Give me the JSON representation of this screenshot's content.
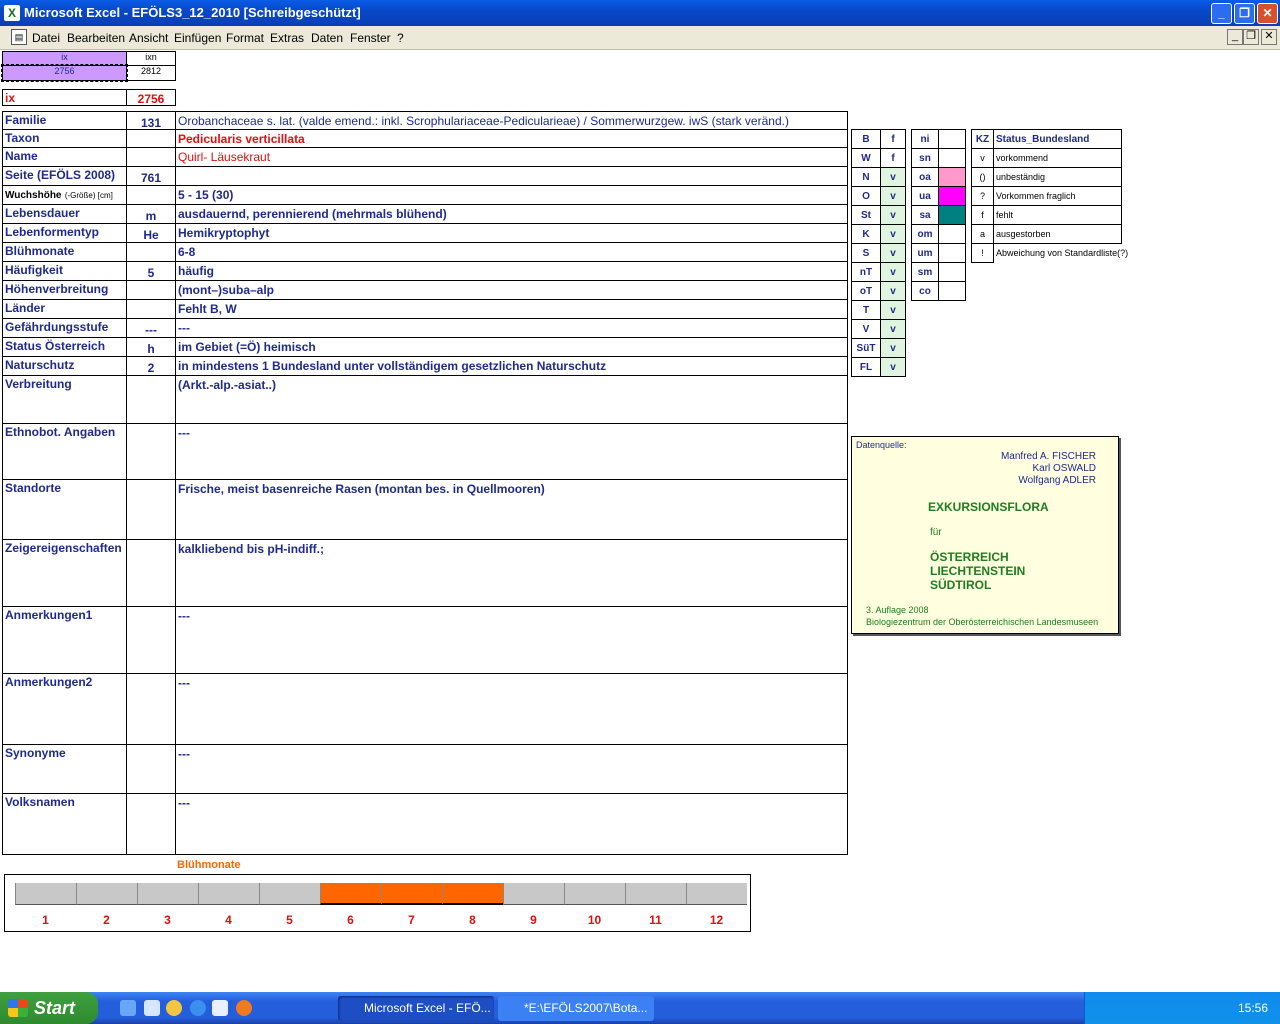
{
  "window": {
    "title": "Microsoft Excel - EFÖLS3_12_2010  [Schreibgeschützt]",
    "btn_min": "_",
    "btn_restore": "❐",
    "btn_close": "✕"
  },
  "menu": [
    "Datei",
    "Bearbeiten",
    "Ansicht",
    "Einfügen",
    "Format",
    "Extras",
    "Daten",
    "Fenster",
    "?"
  ],
  "mdi": {
    "min": "_",
    "restore": "❐",
    "close": "✕"
  },
  "index": {
    "h1": "ix",
    "h2": "ixn",
    "v1": "2756",
    "v2": "2812",
    "ix_label": "ix",
    "ix_value": "2756"
  },
  "rows": [
    {
      "label": "Familie",
      "code": "131",
      "value": "Orobanchaceae s. lat. (valde emend.: inkl. Scrophulariaceae-Pedicularieae)  /  Sommerwurzgew. iwS (stark veränd.)"
    },
    {
      "label": "Taxon",
      "code": "",
      "value": "Pedicularis verticillata"
    },
    {
      "label": "Name",
      "code": "",
      "value": "Quirl- Läusekraut"
    },
    {
      "label": "Seite (EFÖLS 2008)",
      "code": "761",
      "value": ""
    },
    {
      "label": "Wuchshöhe",
      "label_small": "(-Größe) [cm]",
      "code": "",
      "value": " 5 - 15 (30)"
    },
    {
      "label": "Lebensdauer",
      "code": "m",
      "value": "ausdauernd, perennierend (mehrmals blühend)"
    },
    {
      "label": "Lebenformentyp",
      "code": "He",
      "value": "Hemikryptophyt"
    },
    {
      "label": "Blühmonate",
      "code": "",
      "value": " 6-8"
    },
    {
      "label": "Häufigkeit",
      "code": "5",
      "value": "häufig"
    },
    {
      "label": "Höhenverbreitung",
      "code": "",
      "value": "(mont–)suba–alp"
    },
    {
      "label": "Länder",
      "code": "",
      "value": "Fehlt B, W"
    },
    {
      "label": "Gefährdungsstufe",
      "code": "---",
      "value": "   ---"
    },
    {
      "label": "Status Österreich",
      "code": "h",
      "value": "im Gebiet (=Ö) heimisch"
    },
    {
      "label": "Naturschutz",
      "code": "2",
      "value": "in mindestens 1 Bundesland unter vollständigem gesetzlichen Naturschutz"
    },
    {
      "label": "Verbreitung",
      "code": "",
      "value": "(Arkt.-alp.-asiat..)"
    },
    {
      "label": "Ethnobot. Angaben",
      "code": "",
      "value": "---"
    },
    {
      "label": "Standorte",
      "code": "",
      "value": "Frische, meist basenreiche Rasen (montan bes. in Quellmooren)"
    },
    {
      "label": "Zeigereigenschaften",
      "code": "",
      "value": "kalkliebend bis pH-indiff.;"
    },
    {
      "label": "Anmerkungen1",
      "code": "",
      "value": "---"
    },
    {
      "label": "Anmerkungen2",
      "code": "",
      "value": "---"
    },
    {
      "label": "Synonyme",
      "code": "",
      "value": "---"
    },
    {
      "label": "Volksnamen",
      "code": "",
      "value": "---"
    }
  ],
  "states": {
    "h1": "B",
    "h2": "f",
    "rows": [
      [
        "W",
        "f"
      ],
      [
        "N",
        "v"
      ],
      [
        "O",
        "v"
      ],
      [
        "St",
        "v"
      ],
      [
        "K",
        "v"
      ],
      [
        "S",
        "v"
      ],
      [
        "nT",
        "v"
      ],
      [
        "oT",
        "v"
      ],
      [
        "T",
        "v"
      ],
      [
        "V",
        "v"
      ],
      [
        "SüT",
        "v"
      ],
      [
        "FL",
        "v"
      ]
    ]
  },
  "regions": {
    "h": "ni",
    "rows": [
      "sn",
      "oa",
      "ua",
      "sa",
      "om",
      "um",
      "sm",
      "co"
    ],
    "colors": {
      "oa": "#ff99cc",
      "ua": "#ff00ff",
      "sa": "#008080"
    }
  },
  "legend": {
    "h1": "KZ",
    "h2": "Status_Bundesland",
    "rows": [
      [
        "v",
        "vorkommend"
      ],
      [
        "()",
        "unbeständig"
      ],
      [
        "?",
        "Vorkommen fraglich"
      ],
      [
        "f",
        "fehlt"
      ],
      [
        "a",
        "ausgestorben"
      ],
      [
        "!",
        "Abweichung von Standardliste(?)"
      ]
    ]
  },
  "source": {
    "label": "Datenquelle:",
    "authors": [
      "Manfred A. FISCHER",
      "Karl OSWALD",
      "Wolfgang ADLER"
    ],
    "title": "EXKURSIONSFLORA",
    "fuer": "für",
    "countries": [
      "ÖSTERREICH",
      "LIECHTENSTEIN",
      "SÜDTIROL"
    ],
    "edition": "3. Auflage 2008",
    "publisher": "Biologiezentrum der Oberösterreichischen Landesmuseen"
  },
  "bloom": {
    "title": "Blühmonate",
    "months": [
      "1",
      "2",
      "3",
      "4",
      "5",
      "6",
      "7",
      "8",
      "9",
      "10",
      "11",
      "12"
    ],
    "active": [
      6,
      7,
      8
    ],
    "active_color": "#ff6600",
    "inactive_color": "#c8c8c8"
  },
  "taskbar": {
    "start": "Start",
    "tasks": [
      "Microsoft Excel - EFÖ...",
      "*E:\\EFÖLS2007\\Bota..."
    ],
    "clock": "15:56"
  }
}
